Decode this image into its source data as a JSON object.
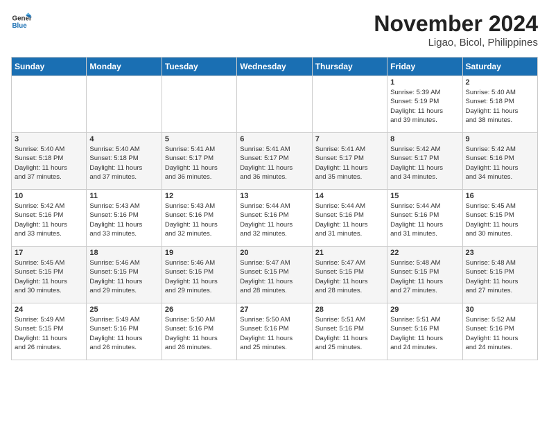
{
  "logo": {
    "line1": "General",
    "line2": "Blue"
  },
  "title": "November 2024",
  "subtitle": "Ligao, Bicol, Philippines",
  "days_of_week": [
    "Sunday",
    "Monday",
    "Tuesday",
    "Wednesday",
    "Thursday",
    "Friday",
    "Saturday"
  ],
  "weeks": [
    [
      {
        "day": "",
        "info": ""
      },
      {
        "day": "",
        "info": ""
      },
      {
        "day": "",
        "info": ""
      },
      {
        "day": "",
        "info": ""
      },
      {
        "day": "",
        "info": ""
      },
      {
        "day": "1",
        "info": "Sunrise: 5:39 AM\nSunset: 5:19 PM\nDaylight: 11 hours\nand 39 minutes."
      },
      {
        "day": "2",
        "info": "Sunrise: 5:40 AM\nSunset: 5:18 PM\nDaylight: 11 hours\nand 38 minutes."
      }
    ],
    [
      {
        "day": "3",
        "info": "Sunrise: 5:40 AM\nSunset: 5:18 PM\nDaylight: 11 hours\nand 37 minutes."
      },
      {
        "day": "4",
        "info": "Sunrise: 5:40 AM\nSunset: 5:18 PM\nDaylight: 11 hours\nand 37 minutes."
      },
      {
        "day": "5",
        "info": "Sunrise: 5:41 AM\nSunset: 5:17 PM\nDaylight: 11 hours\nand 36 minutes."
      },
      {
        "day": "6",
        "info": "Sunrise: 5:41 AM\nSunset: 5:17 PM\nDaylight: 11 hours\nand 36 minutes."
      },
      {
        "day": "7",
        "info": "Sunrise: 5:41 AM\nSunset: 5:17 PM\nDaylight: 11 hours\nand 35 minutes."
      },
      {
        "day": "8",
        "info": "Sunrise: 5:42 AM\nSunset: 5:17 PM\nDaylight: 11 hours\nand 34 minutes."
      },
      {
        "day": "9",
        "info": "Sunrise: 5:42 AM\nSunset: 5:16 PM\nDaylight: 11 hours\nand 34 minutes."
      }
    ],
    [
      {
        "day": "10",
        "info": "Sunrise: 5:42 AM\nSunset: 5:16 PM\nDaylight: 11 hours\nand 33 minutes."
      },
      {
        "day": "11",
        "info": "Sunrise: 5:43 AM\nSunset: 5:16 PM\nDaylight: 11 hours\nand 33 minutes."
      },
      {
        "day": "12",
        "info": "Sunrise: 5:43 AM\nSunset: 5:16 PM\nDaylight: 11 hours\nand 32 minutes."
      },
      {
        "day": "13",
        "info": "Sunrise: 5:44 AM\nSunset: 5:16 PM\nDaylight: 11 hours\nand 32 minutes."
      },
      {
        "day": "14",
        "info": "Sunrise: 5:44 AM\nSunset: 5:16 PM\nDaylight: 11 hours\nand 31 minutes."
      },
      {
        "day": "15",
        "info": "Sunrise: 5:44 AM\nSunset: 5:16 PM\nDaylight: 11 hours\nand 31 minutes."
      },
      {
        "day": "16",
        "info": "Sunrise: 5:45 AM\nSunset: 5:15 PM\nDaylight: 11 hours\nand 30 minutes."
      }
    ],
    [
      {
        "day": "17",
        "info": "Sunrise: 5:45 AM\nSunset: 5:15 PM\nDaylight: 11 hours\nand 30 minutes."
      },
      {
        "day": "18",
        "info": "Sunrise: 5:46 AM\nSunset: 5:15 PM\nDaylight: 11 hours\nand 29 minutes."
      },
      {
        "day": "19",
        "info": "Sunrise: 5:46 AM\nSunset: 5:15 PM\nDaylight: 11 hours\nand 29 minutes."
      },
      {
        "day": "20",
        "info": "Sunrise: 5:47 AM\nSunset: 5:15 PM\nDaylight: 11 hours\nand 28 minutes."
      },
      {
        "day": "21",
        "info": "Sunrise: 5:47 AM\nSunset: 5:15 PM\nDaylight: 11 hours\nand 28 minutes."
      },
      {
        "day": "22",
        "info": "Sunrise: 5:48 AM\nSunset: 5:15 PM\nDaylight: 11 hours\nand 27 minutes."
      },
      {
        "day": "23",
        "info": "Sunrise: 5:48 AM\nSunset: 5:15 PM\nDaylight: 11 hours\nand 27 minutes."
      }
    ],
    [
      {
        "day": "24",
        "info": "Sunrise: 5:49 AM\nSunset: 5:15 PM\nDaylight: 11 hours\nand 26 minutes."
      },
      {
        "day": "25",
        "info": "Sunrise: 5:49 AM\nSunset: 5:16 PM\nDaylight: 11 hours\nand 26 minutes."
      },
      {
        "day": "26",
        "info": "Sunrise: 5:50 AM\nSunset: 5:16 PM\nDaylight: 11 hours\nand 26 minutes."
      },
      {
        "day": "27",
        "info": "Sunrise: 5:50 AM\nSunset: 5:16 PM\nDaylight: 11 hours\nand 25 minutes."
      },
      {
        "day": "28",
        "info": "Sunrise: 5:51 AM\nSunset: 5:16 PM\nDaylight: 11 hours\nand 25 minutes."
      },
      {
        "day": "29",
        "info": "Sunrise: 5:51 AM\nSunset: 5:16 PM\nDaylight: 11 hours\nand 24 minutes."
      },
      {
        "day": "30",
        "info": "Sunrise: 5:52 AM\nSunset: 5:16 PM\nDaylight: 11 hours\nand 24 minutes."
      }
    ]
  ]
}
